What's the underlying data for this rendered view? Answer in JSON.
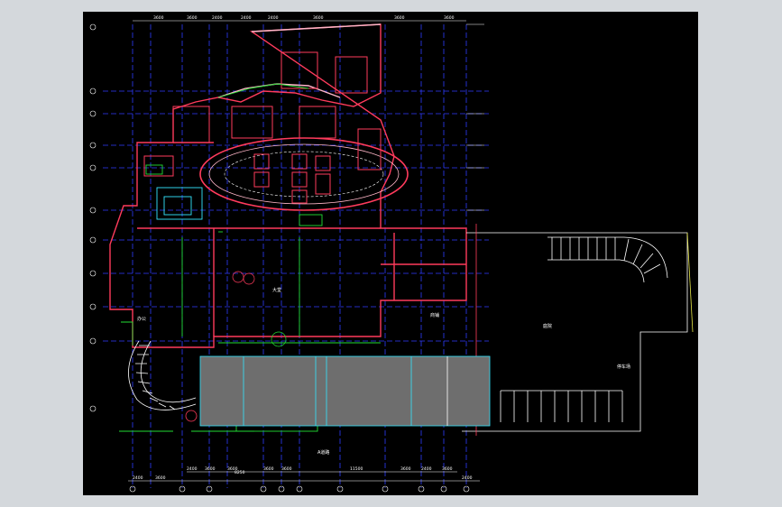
{
  "drawing": {
    "background": "#000000",
    "colors": {
      "grid": "#2f3cff",
      "wall": "#ff3b5c",
      "wall_light": "#ffb6c8",
      "green": "#22dd33",
      "cyan": "#33e6ff",
      "white": "#ffffff",
      "gray_block": "#6e6e6e",
      "yellow": "#e8e84a"
    },
    "axis_top_dims": [
      "3600",
      "3600",
      "2400",
      "2400",
      "2400",
      "3600",
      "3600",
      "3600"
    ],
    "axis_bottom_dims": [
      "2400",
      "3600",
      "2400",
      "3600",
      "3600",
      "3600",
      "3600",
      "11500",
      "3600",
      "2400",
      "3600",
      "2400"
    ],
    "axis_bottom_total": "8250",
    "axis_left_bubbles": [
      "1",
      "2",
      "3",
      "4",
      "5",
      "6",
      "7",
      "8",
      "9",
      "10",
      "11"
    ],
    "labels": {
      "courtyard": "庭院",
      "parking": "停车场",
      "entrance": "入口",
      "street": "A道路",
      "lobby": "大堂",
      "office": "办公",
      "shop": "商铺",
      "hall": "中庭"
    }
  }
}
